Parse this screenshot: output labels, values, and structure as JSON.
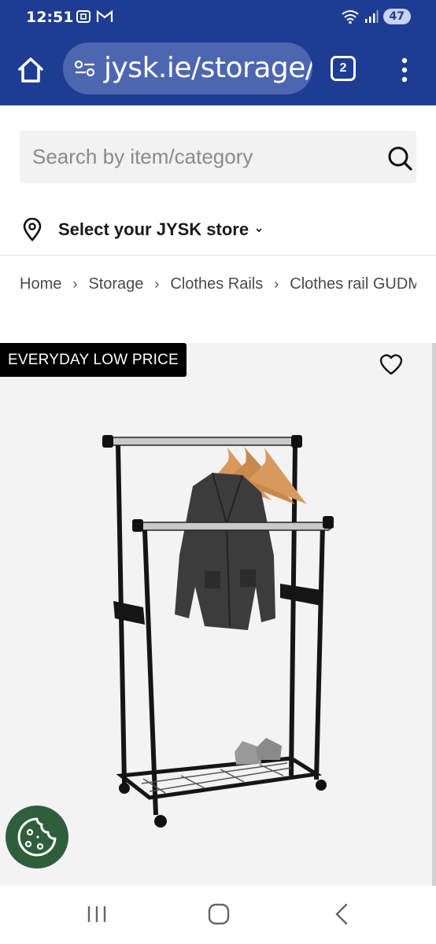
{
  "status_bar": {
    "time": "12:51",
    "battery": "47",
    "icons_left": [
      "screenshot-icon",
      "gmail-icon"
    ],
    "icons_right": [
      "wifi-icon",
      "signal-icon",
      "battery-icon"
    ]
  },
  "browser": {
    "url": "jysk.ie/storage/",
    "tab_count": "2",
    "accent_color": "#1f3c93"
  },
  "search": {
    "placeholder": "Search by item/category",
    "value": ""
  },
  "store": {
    "label": "Select your JYSK store"
  },
  "breadcrumb": {
    "items": [
      "Home",
      "Storage",
      "Clothes Rails",
      "Clothes rail GUDM"
    ],
    "separator": "›"
  },
  "product": {
    "badge": "EVERYDAY LOW PRICE",
    "image_alt": "Clothes rail",
    "wishlist_icon": "heart-icon"
  },
  "cookie": {
    "icon": "cookie-icon",
    "color": "#2e5e3a"
  },
  "nav": {
    "icons": [
      "recent-apps-icon",
      "home-icon",
      "back-icon"
    ]
  }
}
